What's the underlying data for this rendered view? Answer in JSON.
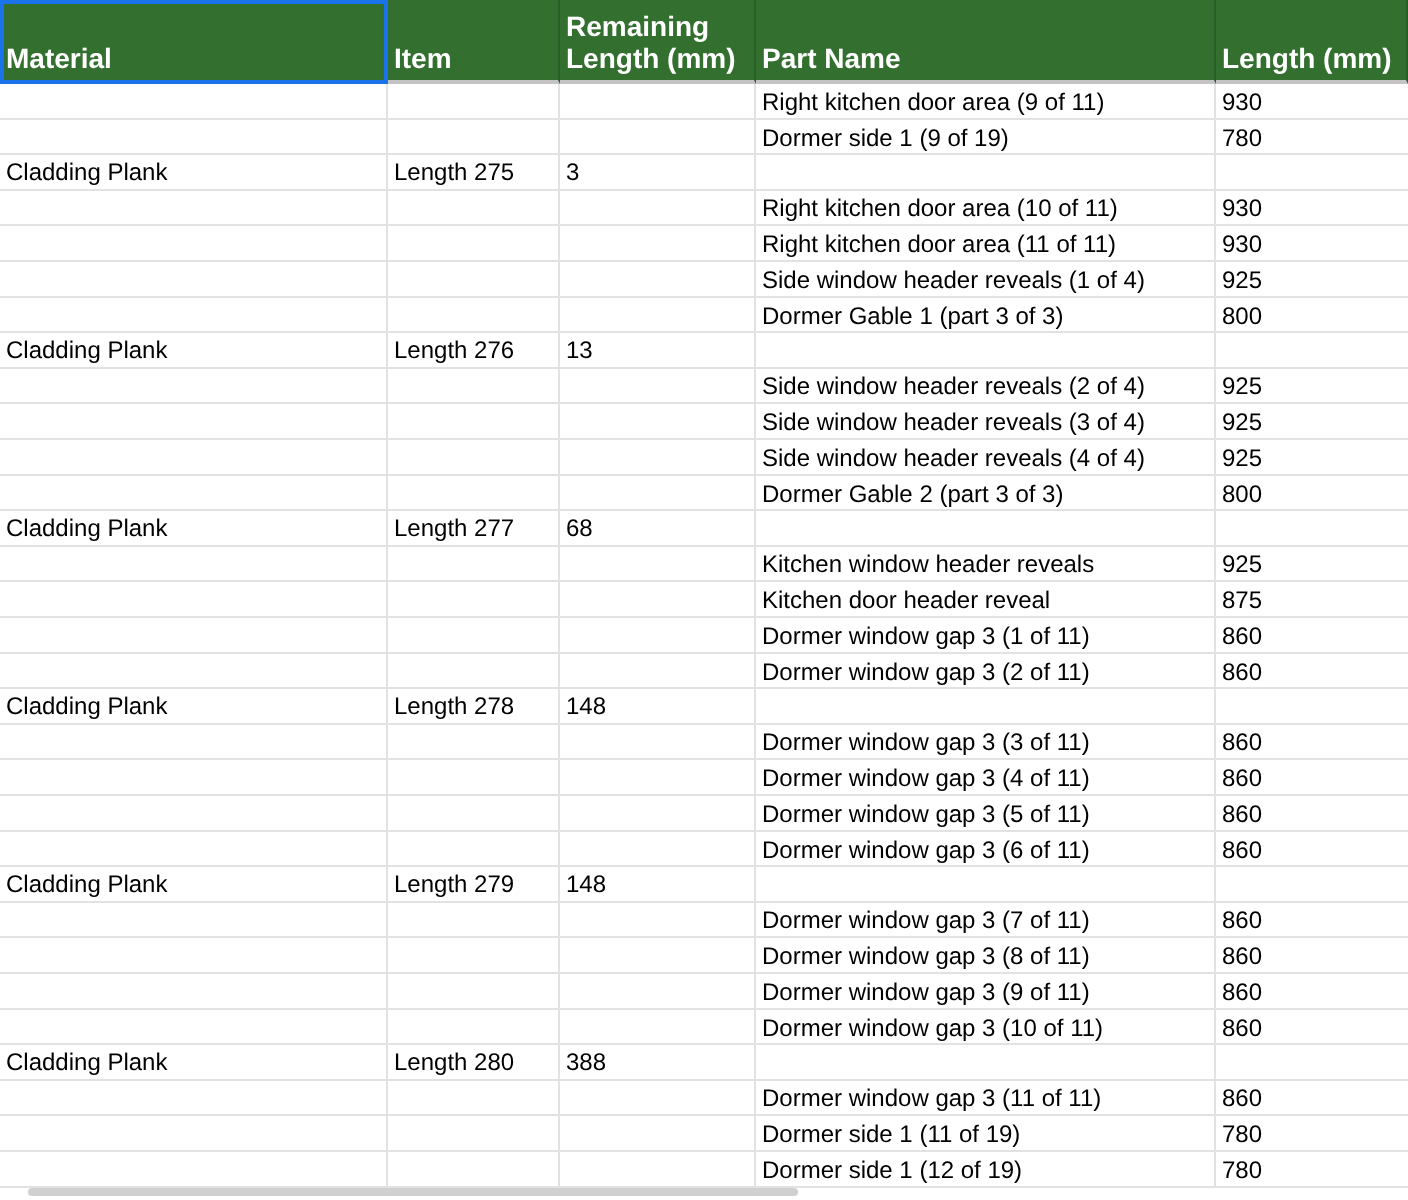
{
  "columns": [
    {
      "label": "Material",
      "selected": true
    },
    {
      "label": "Item",
      "selected": false
    },
    {
      "label": "Remaining Length (mm)",
      "selected": false
    },
    {
      "label": "Part Name",
      "selected": false
    },
    {
      "label": "Length (mm)",
      "selected": false
    }
  ],
  "rows": [
    {
      "part": "Right kitchen door area (9 of 11)",
      "length": "930"
    },
    {
      "part": "Dormer side 1 (9 of 19)",
      "length": "780"
    },
    {
      "material": "Cladding Plank",
      "item": "Length 275",
      "remaining": "3"
    },
    {
      "part": "Right kitchen door area (10 of 11)",
      "length": "930"
    },
    {
      "part": "Right kitchen door area (11 of 11)",
      "length": "930"
    },
    {
      "part": "Side window header reveals (1 of 4)",
      "length": "925"
    },
    {
      "part": "Dormer Gable 1 (part 3 of 3)",
      "length": "800"
    },
    {
      "material": "Cladding Plank",
      "item": "Length 276",
      "remaining": "13"
    },
    {
      "part": "Side window header reveals (2 of 4)",
      "length": "925"
    },
    {
      "part": "Side window header reveals (3 of 4)",
      "length": "925"
    },
    {
      "part": "Side window header reveals (4 of 4)",
      "length": "925"
    },
    {
      "part": "Dormer Gable 2 (part 3 of 3)",
      "length": "800"
    },
    {
      "material": "Cladding Plank",
      "item": "Length 277",
      "remaining": "68"
    },
    {
      "part": "Kitchen window header reveals",
      "length": "925"
    },
    {
      "part": "Kitchen door header reveal",
      "length": "875"
    },
    {
      "part": "Dormer window gap 3 (1 of 11)",
      "length": "860"
    },
    {
      "part": "Dormer window gap 3 (2 of 11)",
      "length": "860"
    },
    {
      "material": "Cladding Plank",
      "item": "Length 278",
      "remaining": "148"
    },
    {
      "part": "Dormer window gap 3 (3 of 11)",
      "length": "860"
    },
    {
      "part": "Dormer window gap 3 (4 of 11)",
      "length": "860"
    },
    {
      "part": "Dormer window gap 3 (5 of 11)",
      "length": "860"
    },
    {
      "part": "Dormer window gap 3 (6 of 11)",
      "length": "860"
    },
    {
      "material": "Cladding Plank",
      "item": "Length 279",
      "remaining": "148"
    },
    {
      "part": "Dormer window gap 3 (7 of 11)",
      "length": "860"
    },
    {
      "part": "Dormer window gap 3 (8 of 11)",
      "length": "860"
    },
    {
      "part": "Dormer window gap 3 (9 of 11)",
      "length": "860"
    },
    {
      "part": "Dormer window gap 3 (10 of 11)",
      "length": "860"
    },
    {
      "material": "Cladding Plank",
      "item": "Length 280",
      "remaining": "388"
    },
    {
      "part": "Dormer window gap 3 (11 of 11)",
      "length": "860"
    },
    {
      "part": "Dormer side 1 (11 of 19)",
      "length": "780"
    },
    {
      "part": "Dormer side 1 (12 of 19)",
      "length": "780"
    }
  ]
}
